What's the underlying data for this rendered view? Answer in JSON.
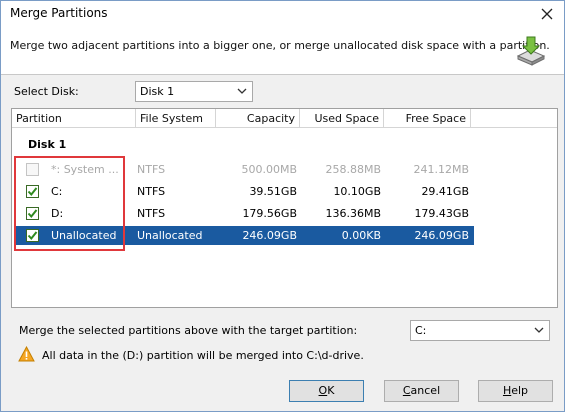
{
  "window": {
    "title": "Merge Partitions"
  },
  "header": {
    "description": "Merge two adjacent partitions into a bigger one, or merge unallocated disk space with a partition."
  },
  "select_disk": {
    "label": "Select Disk:",
    "value": "Disk 1"
  },
  "table": {
    "columns": [
      "Partition",
      "File System",
      "Capacity",
      "Used Space",
      "Free Space"
    ],
    "group": "Disk 1",
    "rows": [
      {
        "partition": "*: System ...",
        "fs": "NTFS",
        "capacity": "500.00MB",
        "used": "258.88MB",
        "free": "241.12MB",
        "checked": false,
        "disabled": true,
        "selected": false
      },
      {
        "partition": "C:",
        "fs": "NTFS",
        "capacity": "39.51GB",
        "used": "10.10GB",
        "free": "29.41GB",
        "checked": true,
        "disabled": false,
        "selected": false
      },
      {
        "partition": "D:",
        "fs": "NTFS",
        "capacity": "179.56GB",
        "used": "136.36MB",
        "free": "179.43GB",
        "checked": true,
        "disabled": false,
        "selected": false
      },
      {
        "partition": "Unallocated",
        "fs": "Unallocated",
        "capacity": "246.09GB",
        "used": "0.00KB",
        "free": "246.09GB",
        "checked": true,
        "disabled": false,
        "selected": true
      }
    ]
  },
  "target": {
    "label": "Merge the selected partitions above with the target partition:",
    "value": "C:"
  },
  "warning": {
    "text": "All data in the (D:) partition will be merged into C:\\d-drive."
  },
  "buttons": {
    "ok_hot": "O",
    "ok_rest": "K",
    "cancel_hot": "C",
    "cancel_rest": "ancel",
    "help_hot": "H",
    "help_rest": "elp"
  },
  "colors": {
    "selection": "#1a5aa0",
    "highlight": "#e0383b",
    "check": "#2f8a1f"
  }
}
